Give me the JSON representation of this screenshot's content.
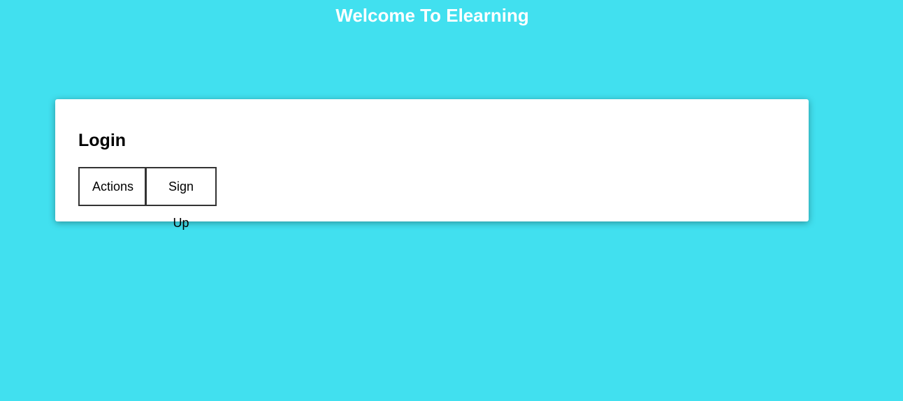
{
  "header": {
    "title": "Welcome To Elearning"
  },
  "login_card": {
    "title": "Login",
    "buttons": [
      {
        "label": "Actions"
      },
      {
        "label": "Sign Up"
      }
    ]
  },
  "colors": {
    "background": "#41e0ef",
    "card": "#ffffff",
    "title_text": "#ffffff",
    "button_border": "#333333"
  }
}
